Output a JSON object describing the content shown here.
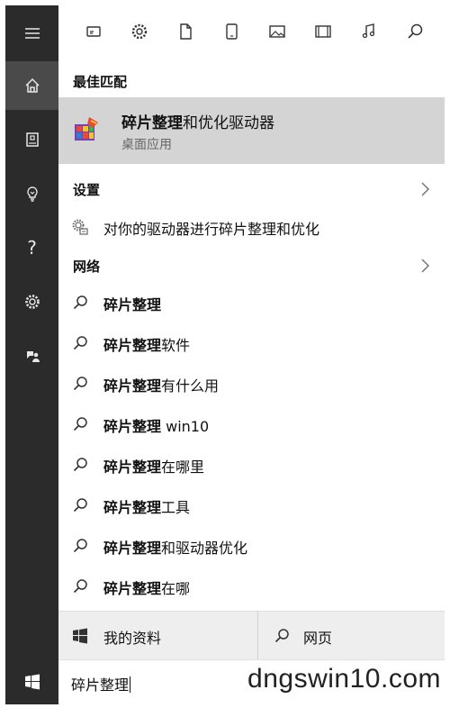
{
  "top_filters": [
    {
      "icon": "app-icon"
    },
    {
      "icon": "settings-icon"
    },
    {
      "icon": "document-icon"
    },
    {
      "icon": "tablet-icon"
    },
    {
      "icon": "photo-icon"
    },
    {
      "icon": "video-icon"
    },
    {
      "icon": "music-icon"
    },
    {
      "icon": "search-icon"
    }
  ],
  "rail": [
    {
      "icon": "menu-icon"
    },
    {
      "icon": "home-icon",
      "active": true
    },
    {
      "icon": "notebook-icon"
    },
    {
      "icon": "lightbulb-icon"
    },
    {
      "icon": "help-icon",
      "text": "?"
    },
    {
      "icon": "settings-icon"
    },
    {
      "icon": "feedback-icon"
    }
  ],
  "best_match": {
    "section_label": "最佳匹配",
    "title_bold": "碎片整理",
    "title_rest": "和优化驱动器",
    "subtitle": "桌面应用"
  },
  "settings": {
    "section_label": "设置",
    "item": "对你的驱动器进行碎片整理和优化"
  },
  "web": {
    "section_label": "网络",
    "suggestions": [
      {
        "bold": "碎片整理",
        "rest": ""
      },
      {
        "bold": "碎片整理",
        "rest": "软件"
      },
      {
        "bold": "碎片整理",
        "rest": "有什么用"
      },
      {
        "bold": "碎片整理",
        "rest": " win10"
      },
      {
        "bold": "碎片整理",
        "rest": "在哪里"
      },
      {
        "bold": "碎片整理",
        "rest": "工具"
      },
      {
        "bold": "碎片整理",
        "rest": "和驱动器优化"
      },
      {
        "bold": "碎片整理",
        "rest": "在哪"
      }
    ]
  },
  "bottom_tabs": {
    "my_stuff": "我的资料",
    "web": "网页"
  },
  "search": {
    "value": "碎片整理"
  },
  "watermark": "dngswin10.com",
  "colors": {
    "rail": "#2b2b2b",
    "rail_active": "#4a4a4a",
    "best_match_bg": "#d4d4d4"
  }
}
